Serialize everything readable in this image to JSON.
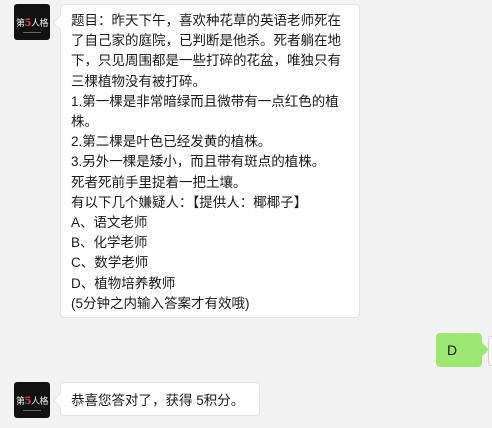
{
  "chat": {
    "bot_avatar": {
      "text_before": "第",
      "text_accent": "5",
      "text_after": "人",
      "text_tail": "格"
    },
    "question_message": {
      "lines": [
        "题目：昨天下午，喜欢种花草的英语老师死在了自己家的庭院，已判断是他杀。死者躺在地下，只见周围都是一些打碎的花盆，唯独只有三棵植物没有被打碎。",
        "1.第一棵是非常暗绿而且微带有一点红色的植株。",
        "2.第二棵是叶色已经发黄的植株。",
        "3.另外一棵是矮小，而且带有斑点的植株。",
        "死者死前手里捉着一把土壤。",
        "有以下几个嫌疑人：【提供人：椰椰子】",
        "A、语文老师",
        "B、化学老师",
        "C、数学老师",
        "D、植物培养教师",
        "(5分钟之内输入答案才有效哦)"
      ]
    },
    "user_reply": {
      "text": "D"
    },
    "result_message": {
      "text": "恭喜您答对了，获得 5积分。"
    }
  }
}
